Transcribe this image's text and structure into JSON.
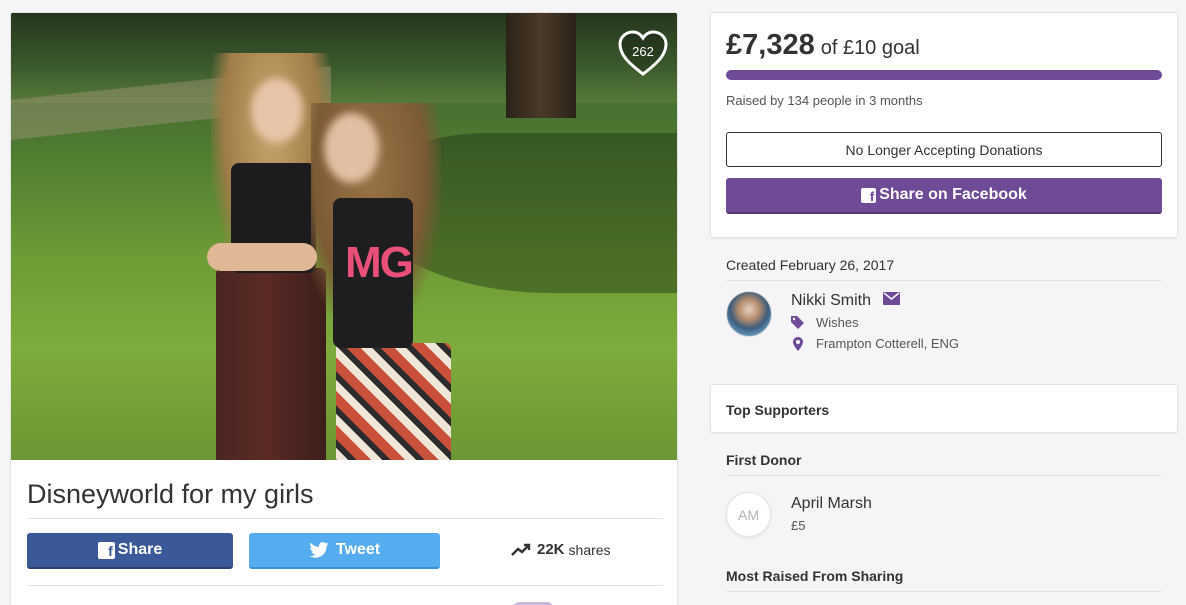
{
  "campaign": {
    "title": "Disneyworld for my girls",
    "hearts": "262"
  },
  "share": {
    "facebook_label": "Share",
    "tweet_label": "Tweet",
    "shares_count": "22K",
    "shares_label": "shares"
  },
  "donation": {
    "raised": "£7,328",
    "goal_text": "of £10 goal",
    "progress_fraction": 1.0,
    "raised_by": "Raised by 134 people in 3 months",
    "no_donations_label": "No Longer Accepting Donations",
    "share_facebook_label": "Share on Facebook"
  },
  "organizer": {
    "created": "Created February 26, 2017",
    "name": "Nikki Smith",
    "category": "Wishes",
    "location": "Frampton Cotterell, ENG"
  },
  "supporters": {
    "title": "Top Supporters",
    "first_donor_label": "First Donor",
    "first_donor": {
      "initials": "AM",
      "name": "April Marsh",
      "amount": "£5"
    },
    "most_raised_label": "Most Raised From Sharing"
  },
  "colors": {
    "brand_purple": "#6f4a96",
    "facebook_blue": "#3b5998",
    "twitter_blue": "#55acee"
  }
}
